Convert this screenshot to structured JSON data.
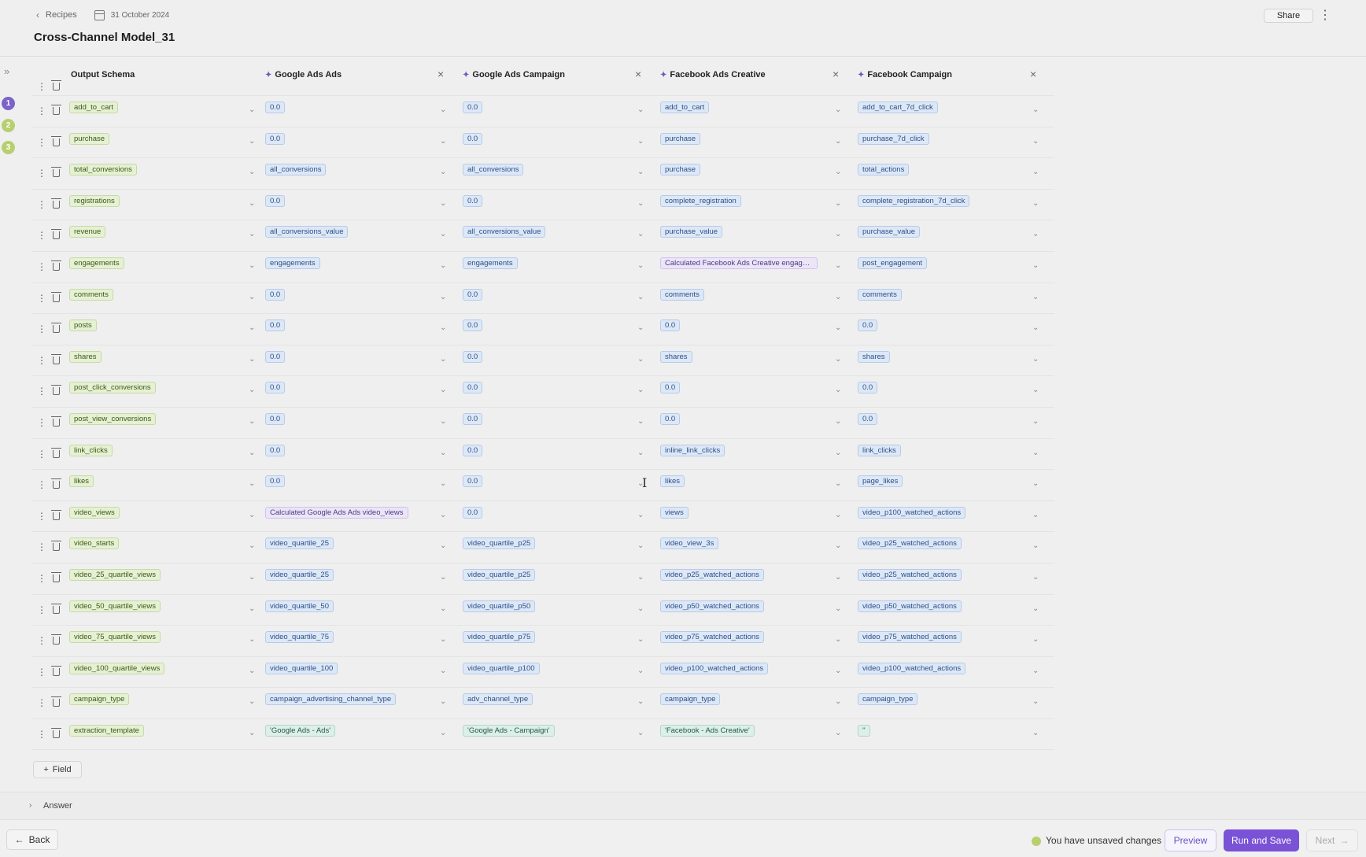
{
  "header": {
    "breadcrumb": "Recipes",
    "date": "31 October 2024",
    "title": "Cross-Channel Model_31",
    "share_label": "Share"
  },
  "steps": [
    "1",
    "2",
    "3"
  ],
  "columns": [
    {
      "label": "Output Schema"
    },
    {
      "label": "Google Ads Ads"
    },
    {
      "label": "Google Ads Campaign"
    },
    {
      "label": "Facebook Ads Creative"
    },
    {
      "label": "Facebook Campaign"
    }
  ],
  "rows": [
    [
      "add_to_cart",
      "0.0",
      "0.0",
      "add_to_cart",
      "add_to_cart_7d_click"
    ],
    [
      "purchase",
      "0.0",
      "0.0",
      "purchase",
      "purchase_7d_click"
    ],
    [
      "total_conversions",
      "all_conversions",
      "all_conversions",
      "purchase",
      "total_actions"
    ],
    [
      "registrations",
      "0.0",
      "0.0",
      "complete_registration",
      "complete_registration_7d_click"
    ],
    [
      "revenue",
      "all_conversions_value",
      "all_conversions_value",
      "purchase_value",
      "purchase_value"
    ],
    [
      "engagements",
      "engagements",
      "engagements",
      "Calculated Facebook Ads Creative engagem...",
      "post_engagement"
    ],
    [
      "comments",
      "0.0",
      "0.0",
      "comments",
      "comments"
    ],
    [
      "posts",
      "0.0",
      "0.0",
      "0.0",
      "0.0"
    ],
    [
      "shares",
      "0.0",
      "0.0",
      "shares",
      "shares"
    ],
    [
      "post_click_conversions",
      "0.0",
      "0.0",
      "0.0",
      "0.0"
    ],
    [
      "post_view_conversions",
      "0.0",
      "0.0",
      "0.0",
      "0.0"
    ],
    [
      "link_clicks",
      "0.0",
      "0.0",
      "inline_link_clicks",
      "link_clicks"
    ],
    [
      "likes",
      "0.0",
      "0.0",
      "likes",
      "page_likes"
    ],
    [
      "video_views",
      "Calculated Google Ads Ads video_views",
      "0.0",
      "views",
      "video_p100_watched_actions"
    ],
    [
      "video_starts",
      "video_quartile_25",
      "video_quartile_p25",
      "video_view_3s",
      "video_p25_watched_actions"
    ],
    [
      "video_25_quartile_views",
      "video_quartile_25",
      "video_quartile_p25",
      "video_p25_watched_actions",
      "video_p25_watched_actions"
    ],
    [
      "video_50_quartile_views",
      "video_quartile_50",
      "video_quartile_p50",
      "video_p50_watched_actions",
      "video_p50_watched_actions"
    ],
    [
      "video_75_quartile_views",
      "video_quartile_75",
      "video_quartile_p75",
      "video_p75_watched_actions",
      "video_p75_watched_actions"
    ],
    [
      "video_100_quartile_views",
      "video_quartile_100",
      "video_quartile_p100",
      "video_p100_watched_actions",
      "video_p100_watched_actions"
    ],
    [
      "campaign_type",
      "campaign_advertising_channel_type",
      "adv_channel_type",
      "campaign_type",
      "campaign_type"
    ],
    [
      "extraction_template",
      "'Google Ads - Ads'",
      "'Google Ads - Campaign'",
      "'Facebook - Ads Creative'",
      "''"
    ]
  ],
  "add_field_label": "Field",
  "answer_label": "Answer",
  "footer": {
    "back_label": "Back",
    "status_text": "You have unsaved changes",
    "preview_label": "Preview",
    "run_label": "Run and Save",
    "next_label": "Next"
  },
  "colors": {
    "accent": "#7a52d6",
    "schema_chip": "#e5f0d4",
    "source_chip": "#dde8f7",
    "status_dot": "#b7cf6e"
  }
}
